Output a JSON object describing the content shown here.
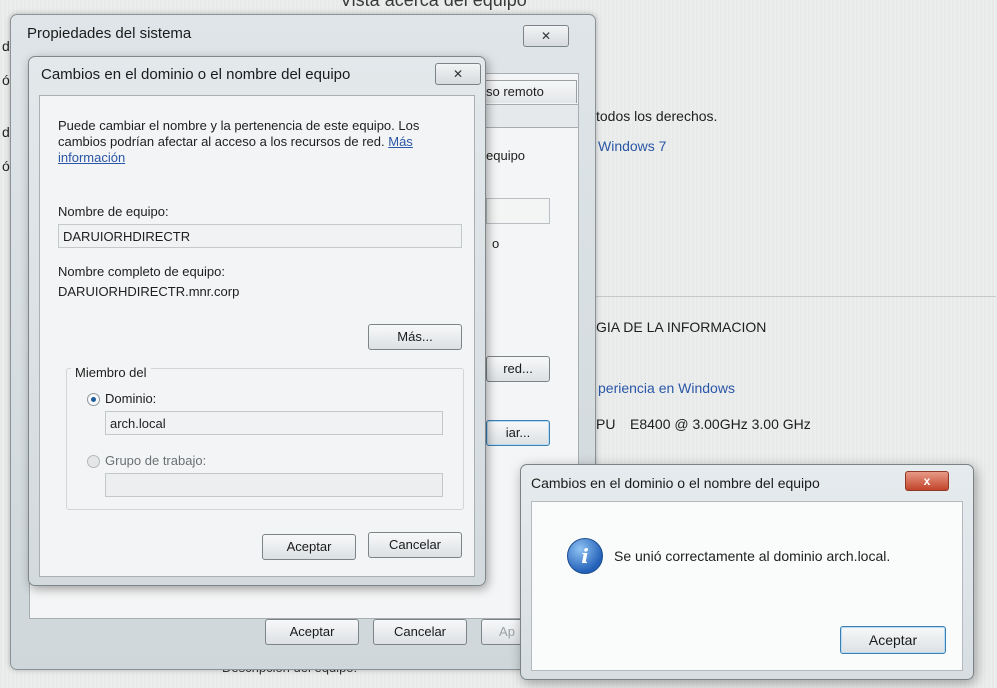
{
  "background": {
    "top_title": "Vista acerca del equipo",
    "rights": "todos los derechos.",
    "windows7": "Windows 7",
    "org": "GIA DE LA INFORMACION",
    "experience": "periencia en Windows",
    "cpu_label": "PU",
    "cpu_value": "E8400 @ 3.00GHz  3.00 GHz",
    "bottom_text": "Descripción del equipo:",
    "edge_letters": [
      "d",
      "ó",
      "de",
      "ó"
    ]
  },
  "sysprop": {
    "title": "Propiedades del sistema",
    "close": "✕",
    "tab_remote": "so remoto",
    "frag_equipo": "equipo",
    "frag_o": "o",
    "btn_red": "red...",
    "btn_cambiar": "iar...",
    "ok": "Aceptar",
    "cancel": "Cancelar",
    "apply": "Ap"
  },
  "domain_dialog": {
    "title": "Cambios en el dominio o el nombre del equipo",
    "close": "✕",
    "intro": "Puede cambiar el nombre y la pertenencia de este equipo. Los cambios podrían afectar al acceso a los recursos de red.",
    "more_info_link": "Más información",
    "computer_name_label": "Nombre de equipo:",
    "computer_name_value": "DARUIORHDIRECTR",
    "full_name_label": "Nombre completo de equipo:",
    "full_name_value": "DARUIORHDIRECTR.mnr.corp",
    "more_button": "Más...",
    "member_of": "Miembro del",
    "domain_label": "Dominio:",
    "domain_value": "arch.local",
    "workgroup_label": "Grupo de trabajo:",
    "workgroup_value": "",
    "ok": "Aceptar",
    "cancel": "Cancelar"
  },
  "message_box": {
    "title": "Cambios en el dominio o el nombre del equipo",
    "close": "x",
    "message": "Se unió correctamente al dominio arch.local.",
    "icon": "info-icon",
    "ok": "Aceptar"
  }
}
